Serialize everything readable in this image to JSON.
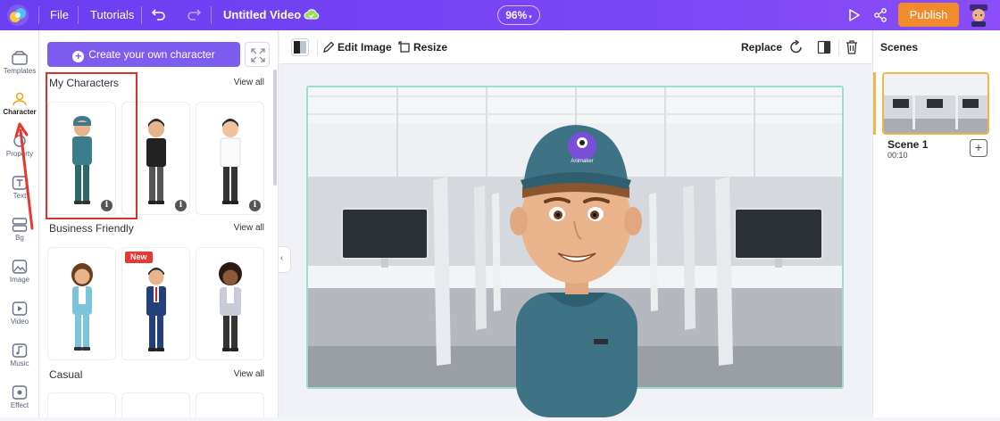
{
  "topbar": {
    "file_label": "File",
    "tutorials_label": "Tutorials",
    "title": "Untitled Video",
    "zoom": "96%",
    "publish_label": "Publish"
  },
  "iconbar": {
    "items": [
      {
        "label": "Templates",
        "icon": "templates-icon"
      },
      {
        "label": "Character",
        "icon": "character-icon"
      },
      {
        "label": "Property",
        "icon": "property-icon"
      },
      {
        "label": "Text",
        "icon": "text-icon"
      },
      {
        "label": "Bg",
        "icon": "bg-icon"
      },
      {
        "label": "Image",
        "icon": "image-icon"
      },
      {
        "label": "Video",
        "icon": "video-icon"
      },
      {
        "label": "Music",
        "icon": "music-icon"
      },
      {
        "label": "Effect",
        "icon": "effect-icon"
      }
    ],
    "active": "Character"
  },
  "panel": {
    "create_label": "Create your own character",
    "sections": [
      {
        "title": "My Characters",
        "view_all": "View all"
      },
      {
        "title": "Business Friendly",
        "view_all": "View all",
        "badge": "New"
      },
      {
        "title": "Casual",
        "view_all": "View all"
      }
    ],
    "info_glyph": "i"
  },
  "toolbar": {
    "edit_image_label": "Edit Image",
    "resize_label": "Resize",
    "replace_label": "Replace"
  },
  "canvas": {
    "cap_logo_text": "Animaker"
  },
  "scenes": {
    "title": "Scenes",
    "items": [
      {
        "name": "Scene 1",
        "duration": "00:10"
      }
    ],
    "add_glyph": "+"
  },
  "colors": {
    "topbar": "#7b45f5",
    "publish": "#f28b2c",
    "create_button": "#7d5cf0",
    "highlight": "#d9342b",
    "stage_border": "#9be0c6",
    "scene_selected": "#f0b64b"
  }
}
